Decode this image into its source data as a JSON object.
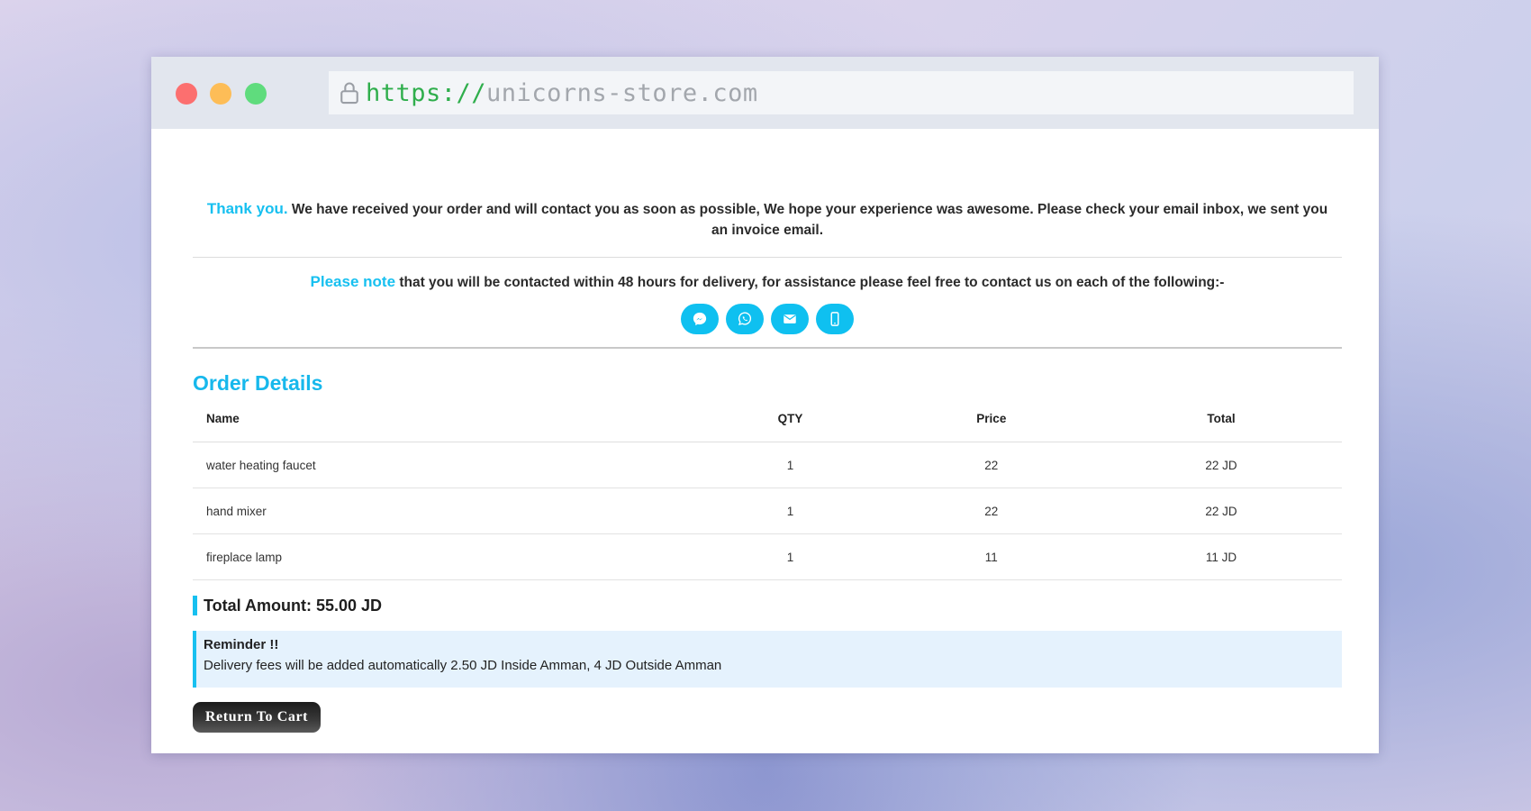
{
  "browser": {
    "url_protocol": "https://",
    "url_host": "unicorns-store.com"
  },
  "thanks": {
    "highlight": "Thank you.",
    "message": " We have received your order and will contact you as soon as possible, We hope your experience was awesome. Please check your email inbox, we sent you an invoice email."
  },
  "note": {
    "highlight": "Please note",
    "message": " that you will be contacted within 48 hours for delivery, for assistance please feel free to contact us on each of the following:-"
  },
  "contact_icons": [
    "messenger-icon",
    "whatsapp-icon",
    "email-icon",
    "phone-icon"
  ],
  "order": {
    "title": "Order Details",
    "headers": {
      "name": "Name",
      "qty": "QTY",
      "price": "Price",
      "total": "Total"
    },
    "rows": [
      {
        "name": "water heating faucet",
        "qty": "1",
        "price": "22",
        "total": "22 JD"
      },
      {
        "name": "hand mixer",
        "qty": "1",
        "price": "22",
        "total": "22 JD"
      },
      {
        "name": "fireplace lamp",
        "qty": "1",
        "price": "11",
        "total": "11 JD"
      }
    ],
    "total_amount": "Total Amount: 55.00 JD"
  },
  "reminder": {
    "title": "Reminder !!",
    "text": "Delivery fees will be added automatically 2.50 JD Inside Amman, 4 JD Outside Amman"
  },
  "actions": {
    "return_label": "Return To Cart"
  },
  "colors": {
    "accent": "#17c0f0",
    "url_protocol": "#2fae4c"
  }
}
